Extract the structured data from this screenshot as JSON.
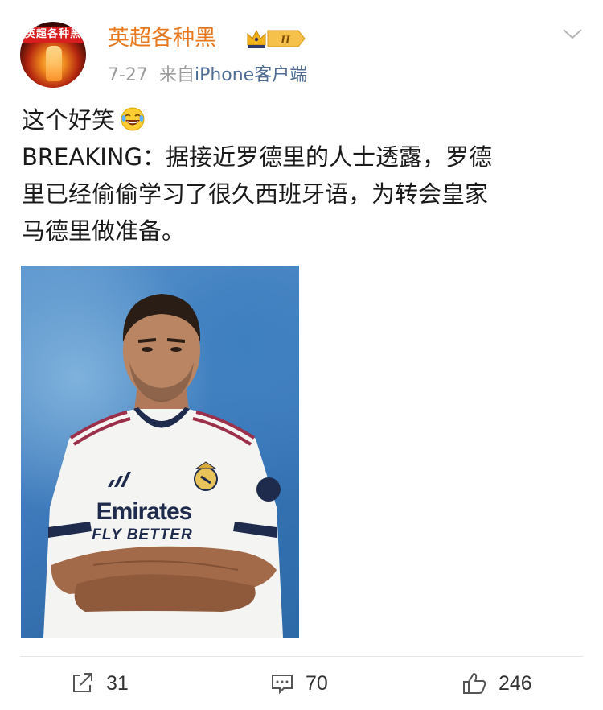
{
  "post": {
    "author": {
      "name": "英超各种黑",
      "avatar_text": "英超各种黑",
      "badge_level": "II"
    },
    "date": "7-27",
    "source_prefix": "来自",
    "source": "iPhone客户端",
    "text_lines": [
      "这个好笑",
      "BREAKING：据接近罗德里的人士透露，罗德",
      "里已经偷偷学习了很久西班牙语，为转会皇家",
      "马德里做准备。"
    ],
    "image": {
      "jersey_sponsor": "Emirates",
      "jersey_tagline": "FLY BETTER"
    }
  },
  "actions": {
    "reposts": "31",
    "comments": "70",
    "likes": "246"
  },
  "colors": {
    "username": "#e8781f",
    "source_link": "#4f6c95",
    "meta": "#9b9b9b",
    "badge_gold": "#f2b21c"
  },
  "icons": [
    "chevron-down-icon",
    "crown-icon",
    "laughing-emoji-icon",
    "repost-icon",
    "comment-icon",
    "like-icon"
  ]
}
